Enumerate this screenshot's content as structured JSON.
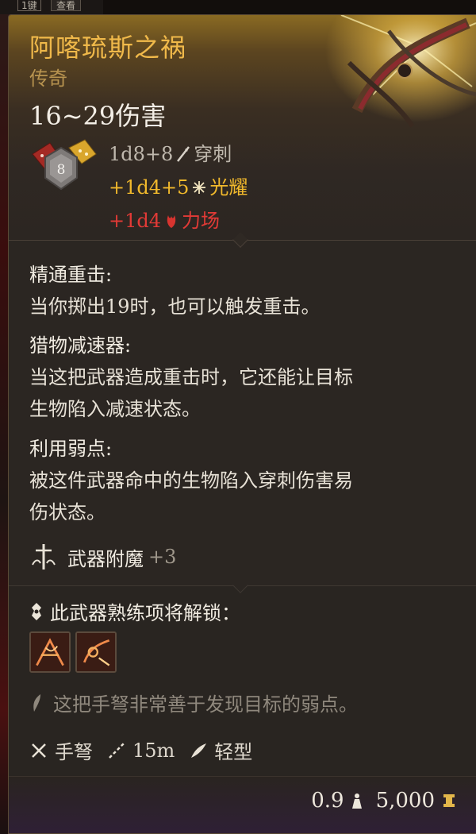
{
  "background": {
    "key_hint": "1键",
    "key_hint2": "查看"
  },
  "item": {
    "name": "阿喀琉斯之祸",
    "rarity": "传奇",
    "damage_range": "16~29伤害",
    "dice_value": "8",
    "damage_lines": [
      {
        "amount": "1d8+8",
        "type": "穿刺",
        "icon": "piercing-icon",
        "color": "#bfb8ad"
      },
      {
        "amount": "+1d4+5",
        "type": "光耀",
        "icon": "radiant-icon",
        "color": "#f1b92c"
      },
      {
        "amount": "+1d4",
        "type": "力场",
        "icon": "force-icon",
        "color": "#e23a36"
      }
    ]
  },
  "features": [
    {
      "title": "精通重击:",
      "text_lines": [
        "当你掷出19时，也可以触发重击。"
      ]
    },
    {
      "title": "猎物减速器:",
      "text_lines": [
        "当这把武器造成重击时，它还能让目标",
        "生物陷入减速状态。"
      ]
    },
    {
      "title": "利用弱点:",
      "text_lines": [
        "被这件武器命中的生物陷入穿刺伤害易",
        "伤状态。"
      ]
    }
  ],
  "enchantment": {
    "label": "武器附魔",
    "value": "+3",
    "icon": "enchant-icon"
  },
  "proficiency": {
    "title": "此武器熟练项将解锁：",
    "icons": [
      "proficiency-action-1-icon",
      "proficiency-action-2-icon"
    ],
    "flavor": "这把手弩非常善于发现目标的弱点。"
  },
  "properties": [
    {
      "icon": "crossbow-icon",
      "label": "手弩"
    },
    {
      "icon": "range-icon",
      "label": "15m"
    },
    {
      "icon": "feather-icon",
      "label": "轻型"
    }
  ],
  "footer": {
    "weight": "0.9",
    "weight_icon": "weight-icon",
    "price": "5,000",
    "price_icon": "gold-icon"
  },
  "colors": {
    "legendary_title": "#f0b94a",
    "rarity": "#b7934f",
    "radiant": "#f1b92c",
    "force": "#e23a36"
  }
}
